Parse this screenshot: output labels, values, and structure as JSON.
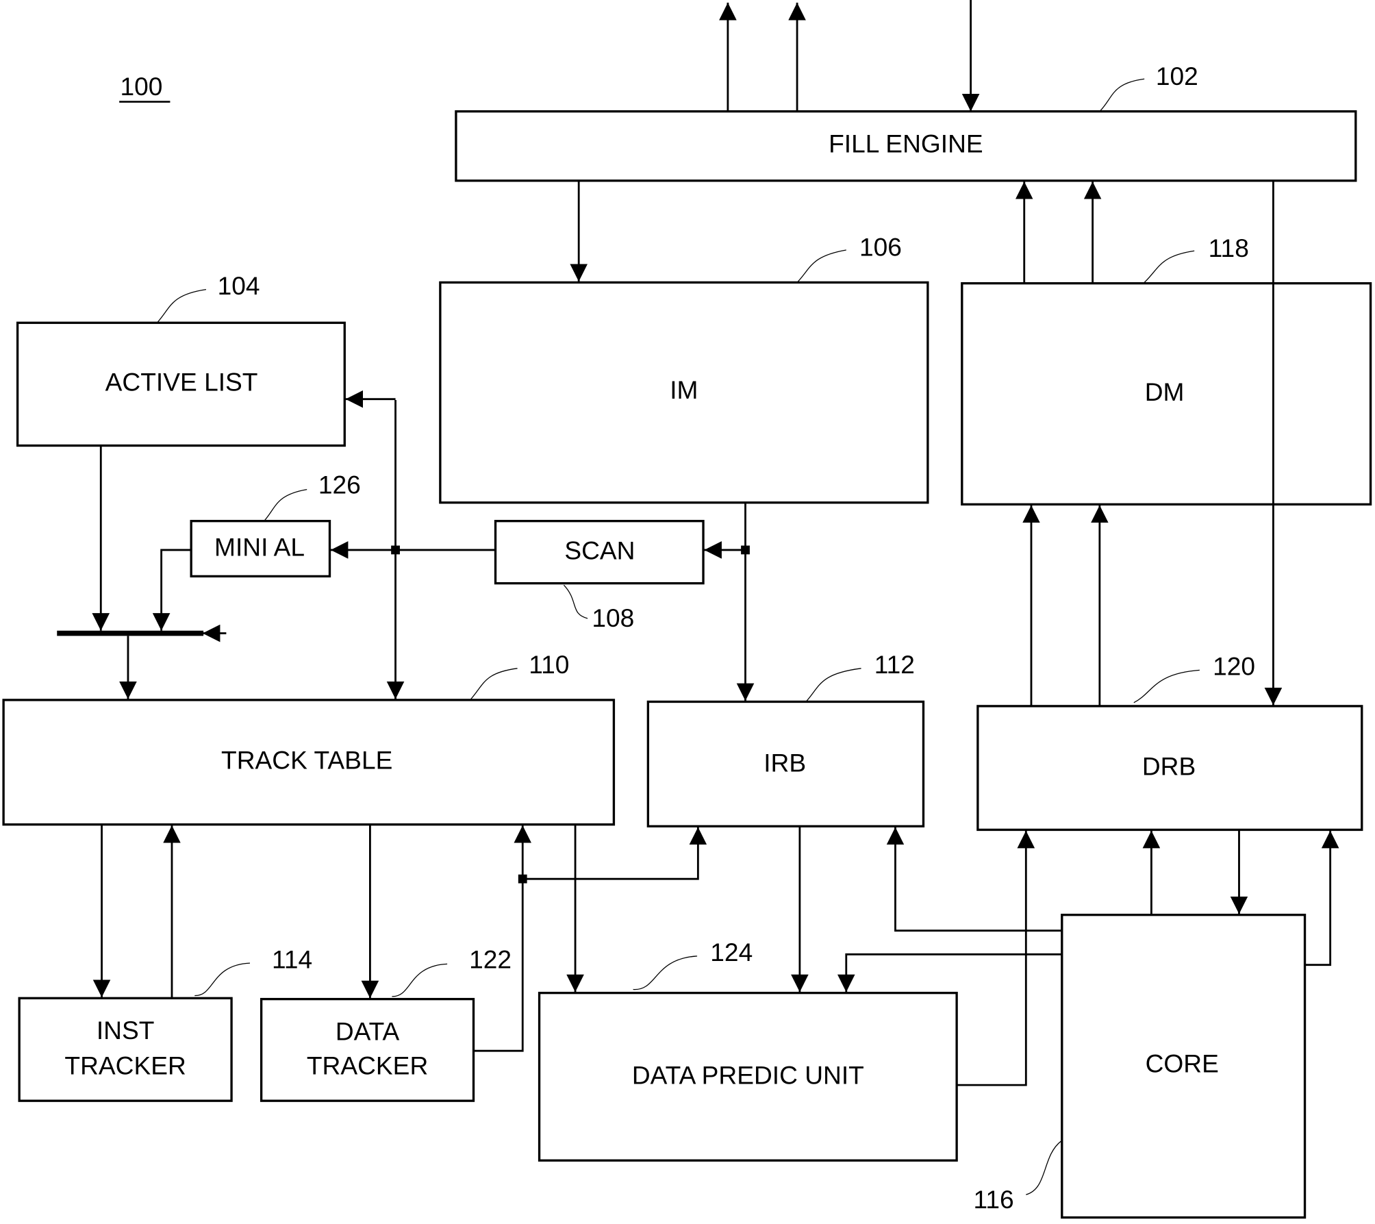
{
  "figure": {
    "number": "100",
    "type": "block diagram"
  },
  "blocks": {
    "fill_engine": {
      "label": "FILL ENGINE",
      "ref": "102"
    },
    "active_list": {
      "label": "ACTIVE LIST",
      "ref": "104"
    },
    "im": {
      "label": "IM",
      "ref": "106"
    },
    "scan": {
      "label": "SCAN",
      "ref": "108"
    },
    "track_table": {
      "label": "TRACK TABLE",
      "ref": "110"
    },
    "irb": {
      "label": "IRB",
      "ref": "112"
    },
    "inst_tracker": {
      "label_line1": "INST",
      "label_line2": "TRACKER",
      "ref": "114"
    },
    "core": {
      "label": "CORE",
      "ref": "116"
    },
    "dm": {
      "label": "DM",
      "ref": "118"
    },
    "drb": {
      "label": "DRB",
      "ref": "120"
    },
    "data_tracker": {
      "label_line1": "DATA",
      "label_line2": "TRACKER",
      "ref": "122"
    },
    "data_predic_unit": {
      "label": "DATA PREDIC UNIT",
      "ref": "124"
    },
    "mini_al": {
      "label": "MINI AL",
      "ref": "126"
    }
  },
  "connections": [
    {
      "from": "fill_engine",
      "to": "external",
      "direction": "up",
      "count": 2
    },
    {
      "from": "external",
      "to": "fill_engine",
      "direction": "down"
    },
    {
      "from": "fill_engine",
      "to": "im"
    },
    {
      "from": "dm",
      "to": "fill_engine",
      "count": 2
    },
    {
      "from": "fill_engine",
      "to": "drb"
    },
    {
      "from": "drb",
      "to": "dm",
      "count": 2
    },
    {
      "from": "im",
      "to": "irb"
    },
    {
      "from": "im",
      "to": "scan"
    },
    {
      "from": "scan",
      "to": "mini_al"
    },
    {
      "from": "scan",
      "to": "active_list"
    },
    {
      "from": "scan",
      "to": "track_table"
    },
    {
      "from": "active_list",
      "to": "selector"
    },
    {
      "from": "mini_al",
      "to": "selector"
    },
    {
      "from": "selector",
      "to": "track_table"
    },
    {
      "from": "track_table",
      "to": "inst_tracker"
    },
    {
      "from": "inst_tracker",
      "to": "track_table"
    },
    {
      "from": "track_table",
      "to": "data_tracker"
    },
    {
      "from": "data_tracker",
      "to": "track_table"
    },
    {
      "from": "data_tracker",
      "to": "irb"
    },
    {
      "from": "track_table",
      "to": "data_predic_unit"
    },
    {
      "from": "irb",
      "to": "data_predic_unit"
    },
    {
      "from": "core",
      "to": "irb"
    },
    {
      "from": "core",
      "to": "data_predic_unit"
    },
    {
      "from": "data_predic_unit",
      "to": "drb"
    },
    {
      "from": "core",
      "to": "drb",
      "count": 2
    },
    {
      "from": "drb",
      "to": "core"
    }
  ]
}
